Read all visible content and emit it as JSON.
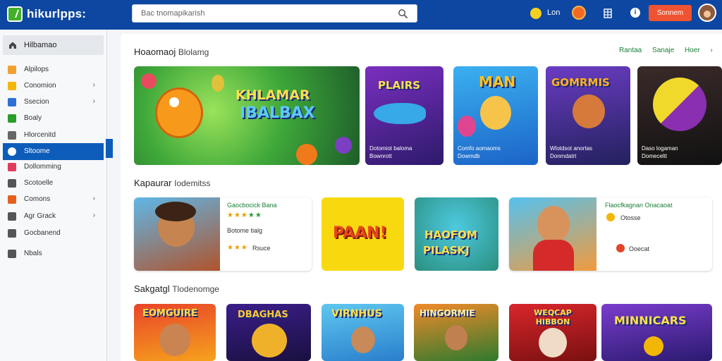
{
  "header": {
    "logo_text": "hikurlpps:",
    "search_placeholder": "Bac tnomapikarish",
    "user_label": "Lon",
    "signin_label": "Sonnem",
    "info_label": "i"
  },
  "sidebar": {
    "heading": "Hilbamao",
    "items": [
      {
        "label": "Alpilops",
        "chevron": false,
        "color": "#f0a030"
      },
      {
        "label": "Conomion",
        "chevron": true,
        "color": "#f2b705"
      },
      {
        "label": "Ssecion",
        "chevron": true,
        "color": "#2f6fd6"
      },
      {
        "label": "Boaly",
        "chevron": false,
        "color": "#2a9d2a"
      },
      {
        "label": "Hlorcenitd",
        "chevron": false,
        "color": "#666666"
      },
      {
        "label": "Sltoome",
        "chevron": false,
        "color": "#0d5cba",
        "active": true
      },
      {
        "label": "Dollomming",
        "chevron": false,
        "color": "#e23a5b"
      },
      {
        "label": "Scotoelle",
        "chevron": false,
        "color": "#555555"
      },
      {
        "label": "Comons",
        "chevron": true,
        "color": "#e55f1f"
      },
      {
        "label": "Agr Grack",
        "chevron": true,
        "color": "#555555"
      },
      {
        "label": "Gocbanend",
        "chevron": false,
        "color": "#555555"
      },
      {
        "label": "Nbals",
        "chevron": false,
        "color": "#555555"
      }
    ],
    "chevron_glyph": "›"
  },
  "featured": {
    "title": "Hoaomaoj",
    "subtitle": "Blolamg",
    "links": [
      "Rantaa",
      "Sanaje",
      "Hoer"
    ],
    "link_arrow": "›",
    "hero_title_line1": "KHLAMAR",
    "hero_title_line2": "IBALBAX",
    "cards": [
      {
        "title": "PLAIRS",
        "caption": "Dotomiot baloma\nBownrott"
      },
      {
        "title": "MAN",
        "caption": "Comfo aomaoms\nDowmdb"
      },
      {
        "title": "GOMRMIS",
        "caption": "Wlotdsot anortas\nDonmdatrt"
      },
      {
        "title": "",
        "caption": "Daso logaman\nDomeceltt"
      }
    ]
  },
  "section2": {
    "title": "Kapaurar",
    "subtitle": "Iodemitss",
    "card1": {
      "title": "Gaocbocick Bana",
      "line2": "Botome tialg",
      "line3": "Rsuce"
    },
    "tile1": "PAAN!",
    "tile2_line1": "HAOFOM",
    "tile2_line2": "PILASKJ",
    "card2": {
      "title": "Flaocfkagnan Onacaoat",
      "line2": "Otosse",
      "line3": "Ooecat"
    }
  },
  "section3": {
    "title": "Sakgatgl",
    "subtitle": "Tlodenomge",
    "tiles": [
      "EOMGUIRE",
      "DBAGHAS",
      "VIRNHUS",
      "HINGORMIE",
      "WEQCAP HIBBON",
      "MINNICARS"
    ]
  },
  "colors": {
    "header_bg": "#0d47a1",
    "accent_green": "#43b02a",
    "signin_bg": "#ef5331",
    "active_sidebar": "#0d5cba"
  }
}
